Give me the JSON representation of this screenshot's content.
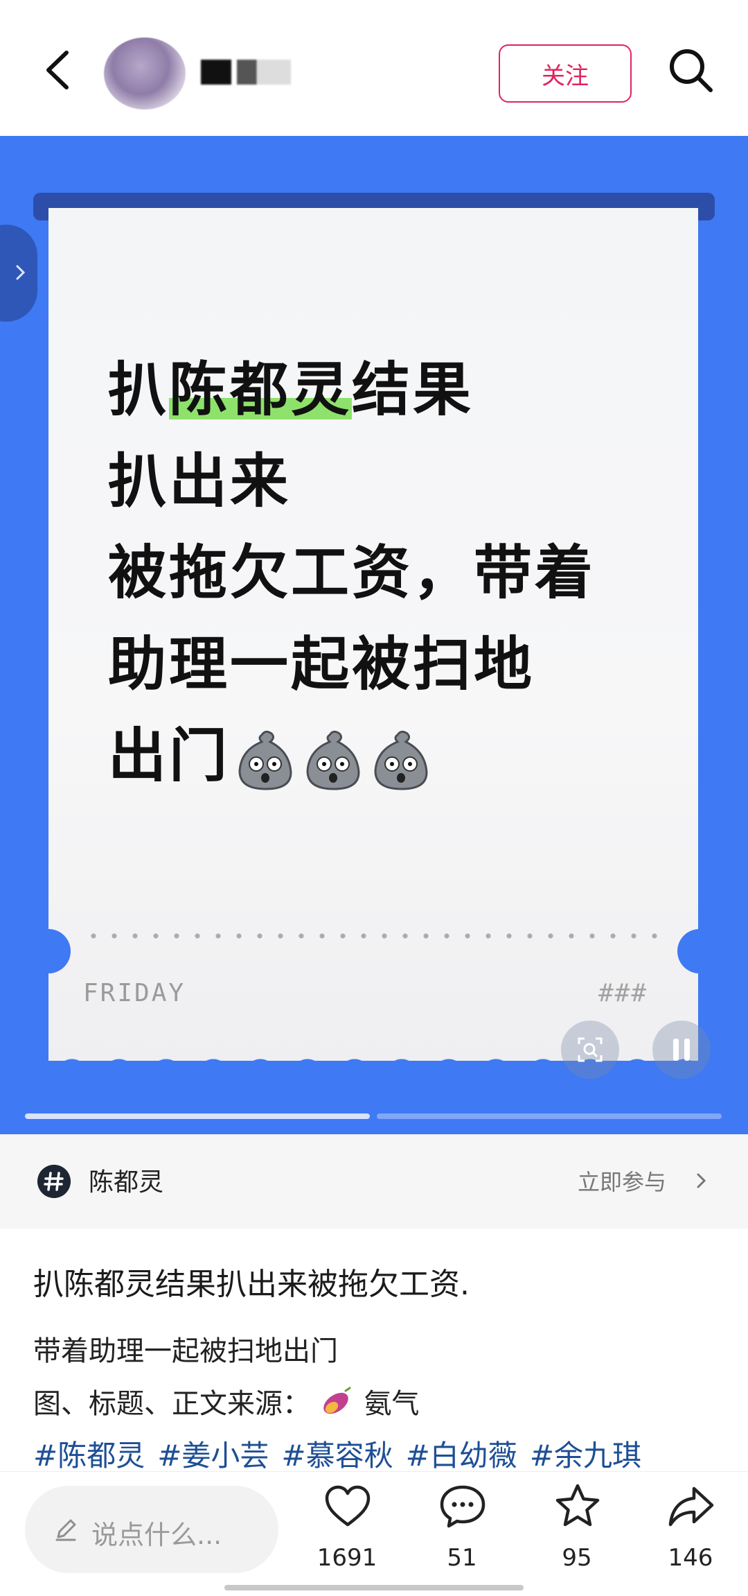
{
  "header": {
    "username": "• • •",
    "follow_label": "关注"
  },
  "post_image": {
    "headline_lines": [
      [
        "扒",
        "陈都灵",
        "结果"
      ],
      "扒出来",
      "被拖欠工资，带着",
      "助理一起被扫地",
      "出门"
    ],
    "highlight_color": "#8ee26b",
    "footer_left": "FRIDAY",
    "footer_right": "###",
    "background_color": "#3f79f3",
    "image_count": 2,
    "current_image": 1
  },
  "topic": {
    "name": "陈都灵",
    "join_label": "立即参与"
  },
  "post": {
    "title": "扒陈都灵结果扒出来被拖欠工资.",
    "line1": "带着助理一起被扫地出门",
    "line2_prefix": "图、标题、正文来源：",
    "line2_source": "氨气",
    "tags": [
      "#陈都灵",
      "#姜小芸",
      "#慕容秋",
      "#白幼薇",
      "#余九琪"
    ]
  },
  "bottom_bar": {
    "comment_placeholder": "说点什么...",
    "likes": "1691",
    "comments": "51",
    "favorites": "95",
    "shares": "146"
  },
  "icons": {
    "back": "chevron-left-icon",
    "search": "search-icon",
    "topic": "hashtag-icon",
    "like": "heart-icon",
    "comment": "chat-bubble-icon",
    "favorite": "star-icon",
    "share": "share-arrow-icon",
    "pause": "pause-icon",
    "scan": "image-scan-icon"
  }
}
